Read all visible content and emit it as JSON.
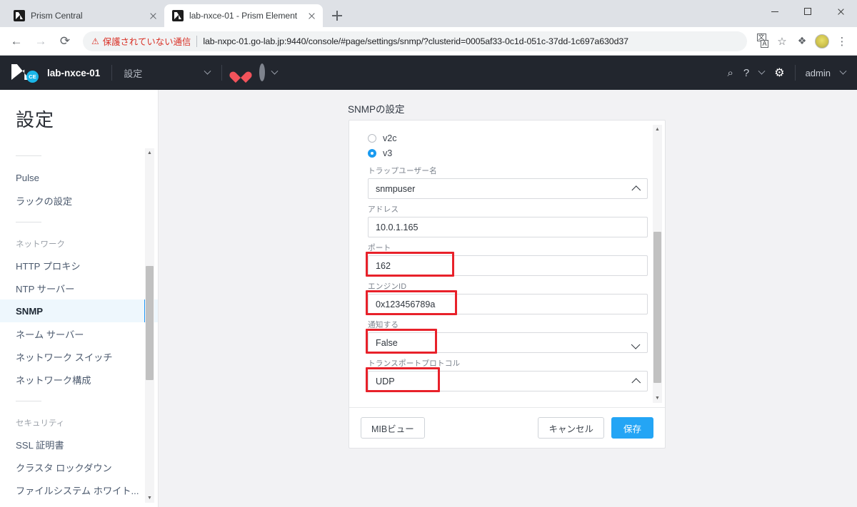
{
  "browser": {
    "tabs": [
      {
        "title": "Prism Central",
        "active": false
      },
      {
        "title": "lab-nxce-01 - Prism Element",
        "active": true
      }
    ],
    "new_tab_label": "+",
    "back_glyph": "←",
    "forward_glyph": "→",
    "reload_glyph": "⟳",
    "security_warning": "保護されていない通信",
    "warning_glyph": "⚠",
    "url": "lab-nxpc-01.go-lab.jp:9440/console/#page/settings/snmp/?clusterid=0005af33-0c1d-051c-37dd-1c697a630d37",
    "star_glyph": "☆",
    "puzzle_glyph": "❖",
    "dots_glyph": "⋮",
    "window_controls": {
      "minimize": "–",
      "maximize": "□",
      "close": "✕"
    }
  },
  "appbar": {
    "logo_badge": "CE",
    "cluster_name": "lab-nxce-01",
    "menu_label": "設定",
    "search_glyph": "⌕",
    "help_glyph": "?",
    "gear_glyph": "⚙",
    "user_label": "admin"
  },
  "sidebar": {
    "title": "設定",
    "items": [
      {
        "label": "Pulse",
        "type": "item",
        "selected": false
      },
      {
        "label": "ラックの設定",
        "type": "item",
        "selected": false
      },
      {
        "label": "",
        "type": "divider"
      },
      {
        "label": "ネットワーク",
        "type": "group"
      },
      {
        "label": "HTTP プロキシ",
        "type": "item",
        "selected": false
      },
      {
        "label": "NTP サーバー",
        "type": "item",
        "selected": false
      },
      {
        "label": "SNMP",
        "type": "item",
        "selected": true
      },
      {
        "label": "ネーム サーバー",
        "type": "item",
        "selected": false
      },
      {
        "label": "ネットワーク スイッチ",
        "type": "item",
        "selected": false
      },
      {
        "label": "ネットワーク構成",
        "type": "item",
        "selected": false
      },
      {
        "label": "",
        "type": "divider"
      },
      {
        "label": "セキュリティ",
        "type": "group"
      },
      {
        "label": "SSL 証明書",
        "type": "item",
        "selected": false
      },
      {
        "label": "クラスタ ロックダウン",
        "type": "item",
        "selected": false
      },
      {
        "label": "ファイルシステム ホワイト...",
        "type": "item",
        "selected": false
      }
    ]
  },
  "main": {
    "panel_title": "SNMPの設定",
    "version_options": [
      {
        "label": "v2c",
        "selected": false
      },
      {
        "label": "v3",
        "selected": true
      }
    ],
    "fields": [
      {
        "label": "トラップユーザー名",
        "value": "snmpuser",
        "control": "dropdown",
        "chevron": "up",
        "highlight": false
      },
      {
        "label": "アドレス",
        "value": "10.0.1.165",
        "control": "text",
        "chevron": "",
        "highlight": false
      },
      {
        "label": "ポート",
        "value": "162",
        "control": "text",
        "chevron": "",
        "highlight": true,
        "hl_width": 124
      },
      {
        "label": "エンジンID",
        "value": "0x123456789a",
        "control": "text",
        "chevron": "",
        "highlight": true,
        "hl_width": 128
      },
      {
        "label": "通知する",
        "value": "False",
        "control": "select",
        "chevron": "down",
        "highlight": true,
        "hl_width": 100
      },
      {
        "label": "トランスポートプロトコル",
        "value": "UDP",
        "control": "dropdown",
        "chevron": "up",
        "highlight": true,
        "hl_width": 104
      }
    ],
    "buttons": {
      "mib_view": "MIBビュー",
      "cancel": "キャンセル",
      "save": "保存"
    }
  },
  "colors": {
    "accent_blue": "#24a5f5",
    "highlight_red": "#e8212a",
    "appbar_dark": "#22262e",
    "selected_bg": "#eef7fd",
    "warning_red": "#d93025"
  }
}
